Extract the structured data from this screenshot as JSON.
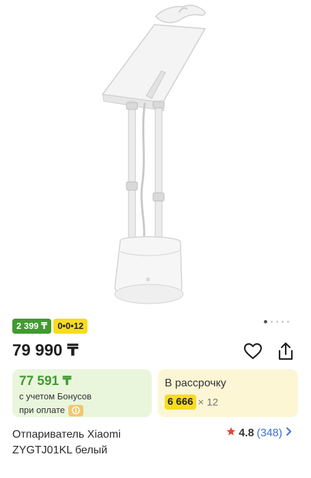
{
  "product": {
    "gallery": {
      "image_alt": "Отпариватель Xiaomi",
      "slide_count": 5,
      "active_slide": 1
    },
    "badges": {
      "price_label": "2 399 ₸",
      "installment_label": "0•0•12"
    },
    "price": "79 990 ₸",
    "bonus_card": {
      "price": "77 591 ₸",
      "line1": "с учетом Бонусов",
      "line2": "при оплате"
    },
    "installment_card": {
      "title": "В рассрочку",
      "amount": "6 666",
      "multiplier": "× 12"
    },
    "title": "Отпариватель Xiaomi ZYGTJ01KL белый",
    "rating": {
      "value": "4.8",
      "count": "(348)"
    },
    "colors": {
      "accent_green": "#3f9b2f",
      "accent_yellow": "#f7dc1e",
      "link_blue": "#3b6fd1",
      "star_red": "#e5473a"
    }
  }
}
